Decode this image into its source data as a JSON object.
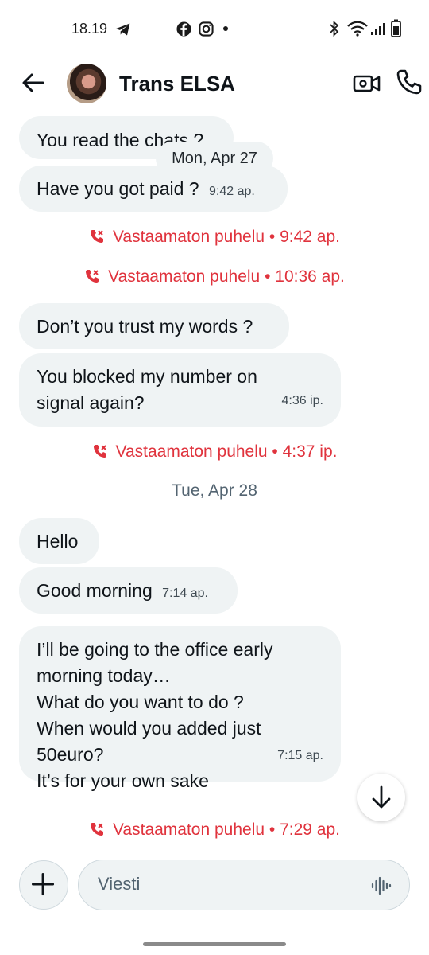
{
  "status_bar": {
    "time": "18.19"
  },
  "header": {
    "contact_name": "Trans ELSA"
  },
  "messages": {
    "m1": {
      "text": "You read the chats ?"
    },
    "date_chip": "Mon, Apr 27",
    "m2": {
      "text": "Have you got paid ?",
      "time": "9:42 ap."
    },
    "call1": "Vastaamaton puhelu • 9:42 ap.",
    "call2": "Vastaamaton puhelu • 10:36 ap.",
    "m3": {
      "text": "Don’t you trust my words ?"
    },
    "m4": {
      "text": "You blocked my number on\nsignal again?",
      "time": "4:36 ip."
    },
    "call3": "Vastaamaton puhelu • 4:37 ip.",
    "date2": "Tue, Apr 28",
    "m5": {
      "text": "Hello"
    },
    "m6": {
      "text": "Good morning",
      "time": "7:14 ap."
    },
    "m7": {
      "text": "I’ll be going to the office early\nmorning today…\nWhat do you want to do ?\nWhen would you added just\n50euro?\nIt’s for your own sake",
      "time": "7:15 ap."
    },
    "call4": "Vastaamaton puhelu • 7:29 ap."
  },
  "composer": {
    "placeholder": "Viesti"
  },
  "colors": {
    "missed_call": "#e0333d",
    "bubble": "#eff3f4"
  }
}
